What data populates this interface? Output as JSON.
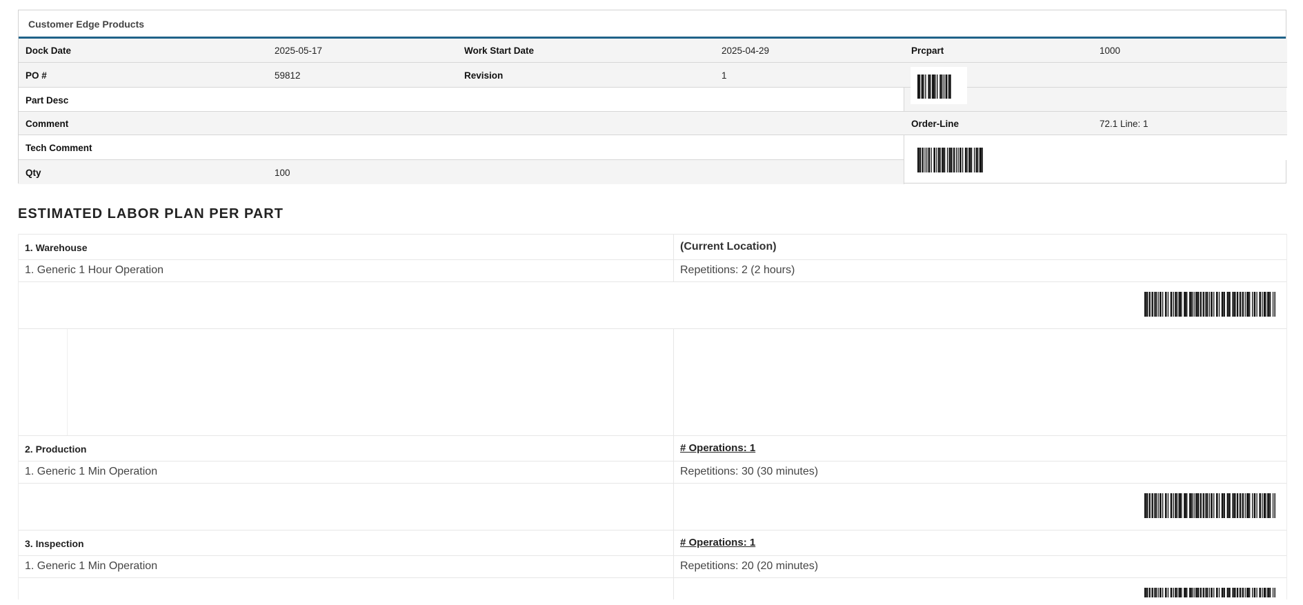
{
  "order": {
    "title": "Customer Edge Products",
    "dock_date_label": "Dock Date",
    "dock_date": "2025-05-17",
    "work_start_label": "Work Start Date",
    "work_start": "2025-04-29",
    "prcpart_label": "Prcpart",
    "prcpart": "1000",
    "po_label": "PO #",
    "po": "59812",
    "revision_label": "Revision",
    "revision": "1",
    "part_desc_label": "Part Desc",
    "part_desc": "",
    "comment_label": "Comment",
    "comment": "",
    "order_line_label": "Order-Line",
    "order_line": "72.1 Line: 1",
    "tech_comment_label": "Tech Comment",
    "tech_comment": "",
    "qty_label": "Qty",
    "qty": "100"
  },
  "labor_plan": {
    "title": "ESTIMATED LABOR PLAN PER PART",
    "departments": [
      {
        "name": "1. Warehouse",
        "header_right": "(Current Location)",
        "operation": "1. Generic 1 Hour Operation",
        "repetitions": "Repetitions: 2 (2 hours)"
      },
      {
        "name": "2. Production",
        "header_right": "# Operations: 1",
        "operation": "1. Generic 1 Min Operation",
        "repetitions": "Repetitions: 30 (30 minutes)"
      },
      {
        "name": "3. Inspection",
        "header_right": "# Operations: 1",
        "operation": "1. Generic 1 Min Operation",
        "repetitions": "Repetitions: 20 (20 minutes)"
      }
    ]
  },
  "icons": [
    "barcode-icon"
  ],
  "colors": {
    "header_rule": "#1f6289",
    "row_shade": "#f4f4f4"
  }
}
